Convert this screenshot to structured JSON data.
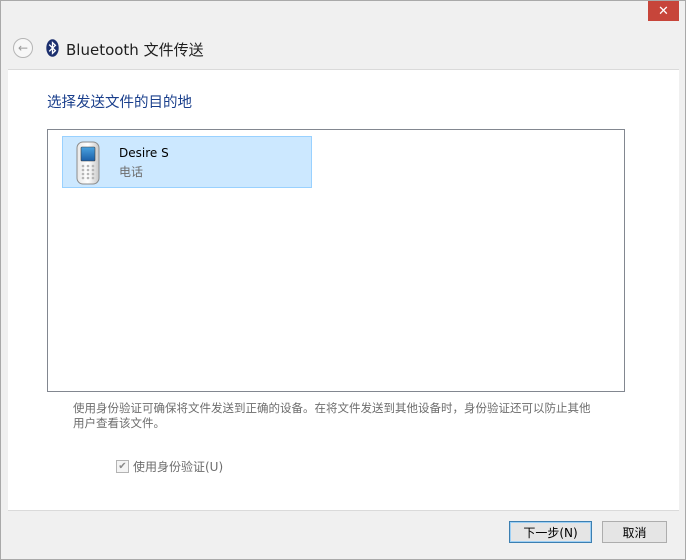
{
  "window": {
    "close_glyph": "✕",
    "title": "Bluetooth 文件传送"
  },
  "header": {
    "back_glyph": "←"
  },
  "main": {
    "instruction": "选择发送文件的目的地",
    "devices": [
      {
        "name": "Desire S",
        "type": "电话",
        "icon": "phone-icon",
        "selected": true
      }
    ],
    "description": "使用身份验证可确保将文件发送到正确的设备。在将文件发送到其他设备时，身份验证还可以防止其他用户查看该文件。",
    "auth_checkbox": {
      "label": "使用身份验证(U)",
      "checked": true,
      "enabled": false,
      "check_glyph": "✔"
    }
  },
  "footer": {
    "next_label": "下一步(N)",
    "cancel_label": "取消"
  },
  "colors": {
    "instruction": "#1a3f8c",
    "selection_bg": "#cce8ff",
    "selection_border": "#99d1ff",
    "close_bg": "#c7453a"
  }
}
